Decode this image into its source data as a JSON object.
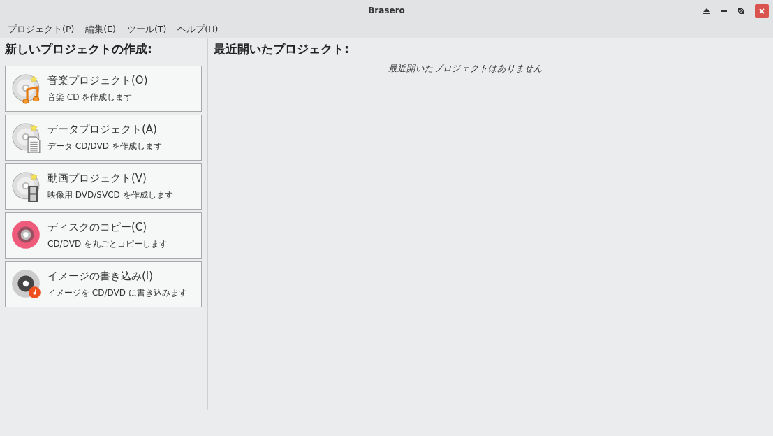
{
  "window": {
    "title": "Brasero"
  },
  "menu": [
    "プロジェクト(P)",
    "編集(E)",
    "ツール(T)",
    "ヘルプ(H)"
  ],
  "new_project": {
    "heading": "新しいプロジェクトの作成:",
    "items": [
      {
        "kind": "audio",
        "title": "音楽プロジェクト(O)",
        "description": "音楽 CD を作成します"
      },
      {
        "kind": "data",
        "title": "データプロジェクト(A)",
        "description": "データ CD/DVD を作成します"
      },
      {
        "kind": "video",
        "title": "動画プロジェクト(V)",
        "description": "映像用 DVD/SVCD を作成します"
      },
      {
        "kind": "copy",
        "title": "ディスクのコピー(C)",
        "description": "CD/DVD を丸ごとコピーします"
      },
      {
        "kind": "burn",
        "title": "イメージの書き込み(I)",
        "description": "イメージを CD/DVD に書き込みます"
      }
    ]
  },
  "recent": {
    "heading": "最近開いたプロジェクト:",
    "empty_message": "最近開いたプロジェクトはありません"
  }
}
